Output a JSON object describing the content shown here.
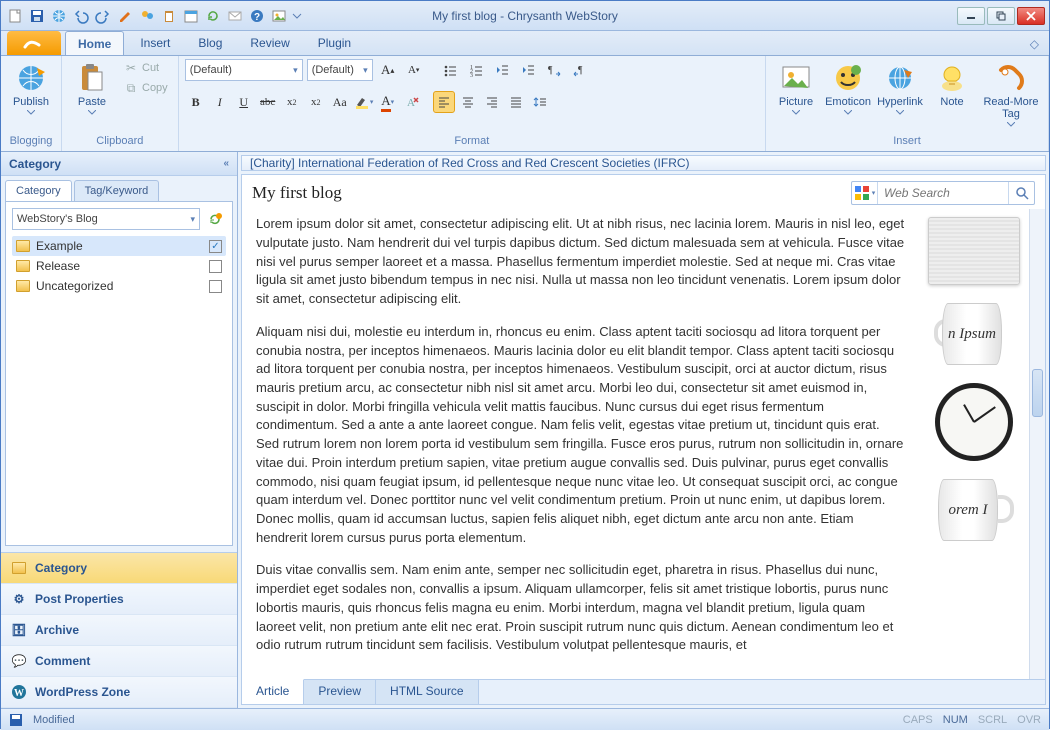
{
  "window": {
    "title": "My first blog - Chrysanth WebStory"
  },
  "ribbon_tabs": {
    "file": "",
    "home": "Home",
    "insert": "Insert",
    "blog": "Blog",
    "review": "Review",
    "plugin": "Plugin"
  },
  "blogging": {
    "label": "Blogging",
    "publish": "Publish"
  },
  "clipboard": {
    "label": "Clipboard",
    "paste": "Paste",
    "cut": "Cut",
    "copy": "Copy"
  },
  "format": {
    "label": "Format",
    "font_family": "(Default)",
    "font_size": "(Default)"
  },
  "insert": {
    "label": "Insert",
    "picture": "Picture",
    "emoticon": "Emoticon",
    "hyperlink": "Hyperlink",
    "note": "Note",
    "readmore": "Read-More Tag"
  },
  "side": {
    "header": "Category",
    "tabs": {
      "category": "Category",
      "tag": "Tag/Keyword"
    },
    "blog": "WebStory's Blog",
    "items": [
      {
        "label": "Example",
        "checked": true
      },
      {
        "label": "Release",
        "checked": false
      },
      {
        "label": "Uncategorized",
        "checked": false
      }
    ],
    "nav": {
      "category": "Category",
      "post_properties": "Post Properties",
      "archive": "Archive",
      "comment": "Comment",
      "wordpress": "WordPress Zone"
    }
  },
  "breadcrumb": "[Charity] International Federation of Red Cross and Red Crescent Societies (IFRC)",
  "doc": {
    "title": "My first blog",
    "search_placeholder": "Web Search",
    "p1": "Lorem ipsum dolor sit amet, consectetur adipiscing elit. Ut at nibh risus, nec lacinia lorem. Mauris in nisl leo, eget vulputate justo. Nam hendrerit dui vel turpis dapibus dictum. Sed dictum malesuada sem at vehicula. Fusce vitae nisi vel purus semper laoreet et a massa. Phasellus fermentum imperdiet molestie. Sed at neque mi. Cras vitae ligula sit amet justo bibendum tempus in nec nisi. Nulla ut massa non leo tincidunt venenatis. Lorem ipsum dolor sit amet, consectetur adipiscing elit.",
    "p2": "Aliquam nisi dui, molestie eu interdum in, rhoncus eu enim. Class aptent taciti sociosqu ad litora torquent per conubia nostra, per inceptos himenaeos. Mauris lacinia dolor eu elit blandit tempor. Class aptent taciti sociosqu ad litora torquent per conubia nostra, per inceptos himenaeos. Vestibulum suscipit, orci at auctor dictum, risus mauris pretium arcu, ac consectetur nibh nisl sit amet arcu. Morbi leo dui, consectetur sit amet euismod in, suscipit in dolor. Morbi fringilla vehicula velit mattis faucibus. Nunc cursus dui eget risus fermentum condimentum. Sed a ante a ante laoreet congue. Nam felis velit, egestas vitae pretium ut, tincidunt quis erat. Sed rutrum lorem non lorem porta id vestibulum sem fringilla. Fusce eros purus, rutrum non sollicitudin in, ornare vitae dui. Proin interdum pretium sapien, vitae pretium augue convallis sed. Duis pulvinar, purus eget convallis commodo, nisi quam feugiat ipsum, id pellentesque neque nunc vitae leo. Ut consequat suscipit orci, ac congue quam interdum vel. Donec porttitor nunc vel velit condimentum pretium. Proin ut nunc enim, ut dapibus lorem. Donec mollis, quam id accumsan luctus, sapien felis aliquet nibh, eget dictum ante arcu non ante. Etiam hendrerit lorem cursus purus porta elementum.",
    "p3": "Duis vitae convallis sem. Nam enim ante, semper nec sollicitudin eget, pharetra in risus. Phasellus dui nunc, imperdiet eget sodales non, convallis a ipsum. Aliquam ullamcorper, felis sit amet tristique lobortis, purus nunc lobortis mauris, quis rhoncus felis magna eu enim. Morbi interdum, magna vel blandit pretium, ligula quam laoreet velit, non pretium ante elit nec erat. Proin suscipit rutrum nunc quis dictum. Aenean condimentum leo et odio rutrum rutrum tincidunt sem facilisis. Vestibulum volutpat pellentesque mauris, et",
    "tabs": {
      "article": "Article",
      "preview": "Preview",
      "html": "HTML Source"
    },
    "mug_text": "n Ipsum",
    "mug_text2": "orem I"
  },
  "status": {
    "modified": "Modified",
    "caps": "CAPS",
    "num": "NUM",
    "scrl": "SCRL",
    "ovr": "OVR"
  }
}
